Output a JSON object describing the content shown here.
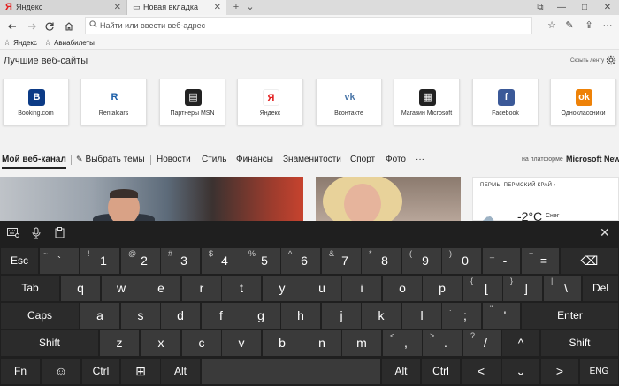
{
  "tabs": [
    {
      "icon": "Я",
      "label": "Яндекс",
      "close": "✕"
    },
    {
      "icon": "▭",
      "label": "Новая вкладка",
      "close": "✕"
    }
  ],
  "tab_controls": {
    "new_tab": "+",
    "tab_list": "⌄"
  },
  "window_controls": {
    "restore": "⧉",
    "minimize": "—",
    "maximize": "□",
    "close": "✕"
  },
  "address_bar": {
    "placeholder": "Найти или ввести веб-адрес"
  },
  "toolbar": {
    "star": "☆",
    "reading": "✎",
    "share": "⇪",
    "more": "···"
  },
  "favorites": [
    {
      "icon": "☆",
      "label": "Яндекс"
    },
    {
      "icon": "☆",
      "label": "Авиабилеты"
    }
  ],
  "top_sites": {
    "title": "Лучшие веб-сайты",
    "hide_feed": "Скрыть ленту",
    "tiles": [
      {
        "label": "Booking.com",
        "glyph": "B",
        "bg": "#0c3b86",
        "fg": "#ffffff"
      },
      {
        "label": "Rentalcars",
        "glyph": "R",
        "bg": "#ffffff",
        "fg": "#1c5fa8"
      },
      {
        "label": "Партнеры MSN",
        "glyph": "▤",
        "bg": "#222222",
        "fg": "#ffffff"
      },
      {
        "label": "Яндекс",
        "glyph": "Я",
        "bg": "#ffffff",
        "fg": "#e31d1d"
      },
      {
        "label": "Вконтакте",
        "glyph": "vk",
        "bg": "#ffffff",
        "fg": "#4a76a8"
      },
      {
        "label": "Магазин Microsoft",
        "glyph": "▦",
        "bg": "#222222",
        "fg": "#ffffff"
      },
      {
        "label": "Facebook",
        "glyph": "f",
        "bg": "#3b5998",
        "fg": "#ffffff"
      },
      {
        "label": "Одноклассники",
        "glyph": "ok",
        "bg": "#ee8208",
        "fg": "#ffffff"
      }
    ]
  },
  "feed_nav": {
    "my_feed": "Мой веб-канал",
    "choose_topics": "Выбрать темы",
    "items": [
      "Новости",
      "Стиль",
      "Финансы",
      "Знаменитости",
      "Спорт",
      "Фото"
    ],
    "more": "···",
    "platform": "на платформе",
    "provider": "Microsoft News"
  },
  "weather": {
    "location": "ПЕРМЬ, ПЕРМСКИЙ КРАЙ",
    "chevron": "›",
    "menu": "···",
    "temperature": "-2°C",
    "condition": "Снег"
  },
  "keyboard": {
    "row1": [
      {
        "main": "Esc",
        "sec": ""
      },
      {
        "main": "`",
        "sec": "~"
      },
      {
        "main": "1",
        "sec": "!"
      },
      {
        "main": "2",
        "sec": "@"
      },
      {
        "main": "3",
        "sec": "#"
      },
      {
        "main": "4",
        "sec": "$"
      },
      {
        "main": "5",
        "sec": "%"
      },
      {
        "main": "6",
        "sec": "^"
      },
      {
        "main": "7",
        "sec": "&"
      },
      {
        "main": "8",
        "sec": "*"
      },
      {
        "main": "9",
        "sec": "("
      },
      {
        "main": "0",
        "sec": ")"
      },
      {
        "main": "-",
        "sec": "_"
      },
      {
        "main": "=",
        "sec": "+"
      },
      {
        "main": "⌫",
        "sec": ""
      }
    ],
    "row2": [
      {
        "main": "Tab",
        "sec": ""
      },
      {
        "main": "q",
        "sec": ""
      },
      {
        "main": "w",
        "sec": ""
      },
      {
        "main": "e",
        "sec": ""
      },
      {
        "main": "r",
        "sec": ""
      },
      {
        "main": "t",
        "sec": ""
      },
      {
        "main": "y",
        "sec": ""
      },
      {
        "main": "u",
        "sec": ""
      },
      {
        "main": "i",
        "sec": ""
      },
      {
        "main": "o",
        "sec": ""
      },
      {
        "main": "p",
        "sec": ""
      },
      {
        "main": "[",
        "sec": "{"
      },
      {
        "main": "]",
        "sec": "}"
      },
      {
        "main": "\\",
        "sec": "|"
      },
      {
        "main": "Del",
        "sec": ""
      }
    ],
    "row3": [
      {
        "main": "Caps",
        "sec": ""
      },
      {
        "main": "a",
        "sec": ""
      },
      {
        "main": "s",
        "sec": ""
      },
      {
        "main": "d",
        "sec": ""
      },
      {
        "main": "f",
        "sec": ""
      },
      {
        "main": "g",
        "sec": ""
      },
      {
        "main": "h",
        "sec": ""
      },
      {
        "main": "j",
        "sec": ""
      },
      {
        "main": "k",
        "sec": ""
      },
      {
        "main": "l",
        "sec": ""
      },
      {
        "main": ";",
        "sec": ":"
      },
      {
        "main": "'",
        "sec": "\""
      },
      {
        "main": "Enter",
        "sec": ""
      }
    ],
    "row4": [
      {
        "main": "Shift",
        "sec": ""
      },
      {
        "main": "z",
        "sec": ""
      },
      {
        "main": "x",
        "sec": ""
      },
      {
        "main": "c",
        "sec": ""
      },
      {
        "main": "v",
        "sec": ""
      },
      {
        "main": "b",
        "sec": ""
      },
      {
        "main": "n",
        "sec": ""
      },
      {
        "main": "m",
        "sec": ""
      },
      {
        "main": ",",
        "sec": "<"
      },
      {
        "main": ".",
        "sec": ">"
      },
      {
        "main": "/",
        "sec": "?"
      },
      {
        "main": "^",
        "sec": ""
      },
      {
        "main": "Shift",
        "sec": ""
      }
    ],
    "row5": [
      {
        "main": "Fn",
        "sec": ""
      },
      {
        "main": "☺",
        "sec": ""
      },
      {
        "main": "Ctrl",
        "sec": ""
      },
      {
        "main": "⊞",
        "sec": ""
      },
      {
        "main": "Alt",
        "sec": ""
      },
      {
        "main": "",
        "sec": ""
      },
      {
        "main": "Alt",
        "sec": ""
      },
      {
        "main": "Ctrl",
        "sec": ""
      },
      {
        "main": "<",
        "sec": ""
      },
      {
        "main": "⌄",
        "sec": ""
      },
      {
        "main": ">",
        "sec": ""
      },
      {
        "main": "ENG",
        "sec": ""
      }
    ]
  }
}
